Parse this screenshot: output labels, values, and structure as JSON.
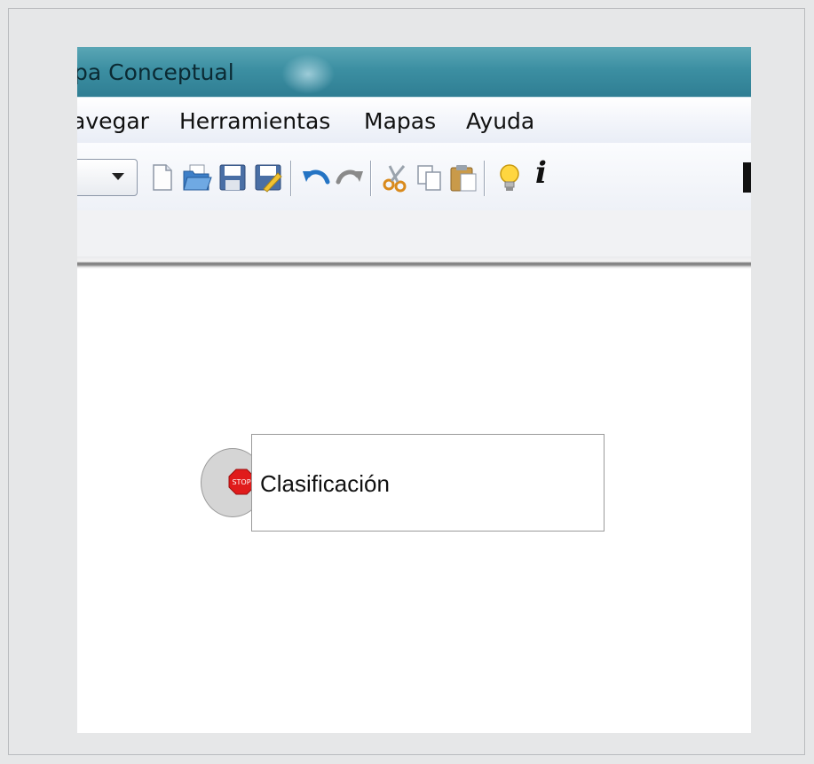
{
  "window": {
    "title": "pa Conceptual"
  },
  "menu": {
    "items": [
      "avegar",
      "Herramientas",
      "Mapas",
      "Ayuda"
    ]
  },
  "toolbar": {
    "buttons": [
      {
        "icon": "new-document-icon"
      },
      {
        "icon": "open-folder-icon"
      },
      {
        "icon": "save-icon"
      },
      {
        "icon": "save-as-icon"
      },
      {
        "icon": "undo-icon"
      },
      {
        "icon": "redo-icon"
      },
      {
        "icon": "cut-icon"
      },
      {
        "icon": "copy-icon"
      },
      {
        "icon": "paste-icon"
      },
      {
        "icon": "lightbulb-icon"
      },
      {
        "icon": "info-icon",
        "label": "i"
      }
    ]
  },
  "canvas": {
    "concept": {
      "label": "Clasificación",
      "icon": "stop-sign-icon",
      "icon_text": "STOP"
    }
  },
  "colors": {
    "titlebar": "#3c8fa2",
    "background": "#e6e7e8",
    "canvas": "#ffffff",
    "stop_red": "#e01b1b"
  }
}
